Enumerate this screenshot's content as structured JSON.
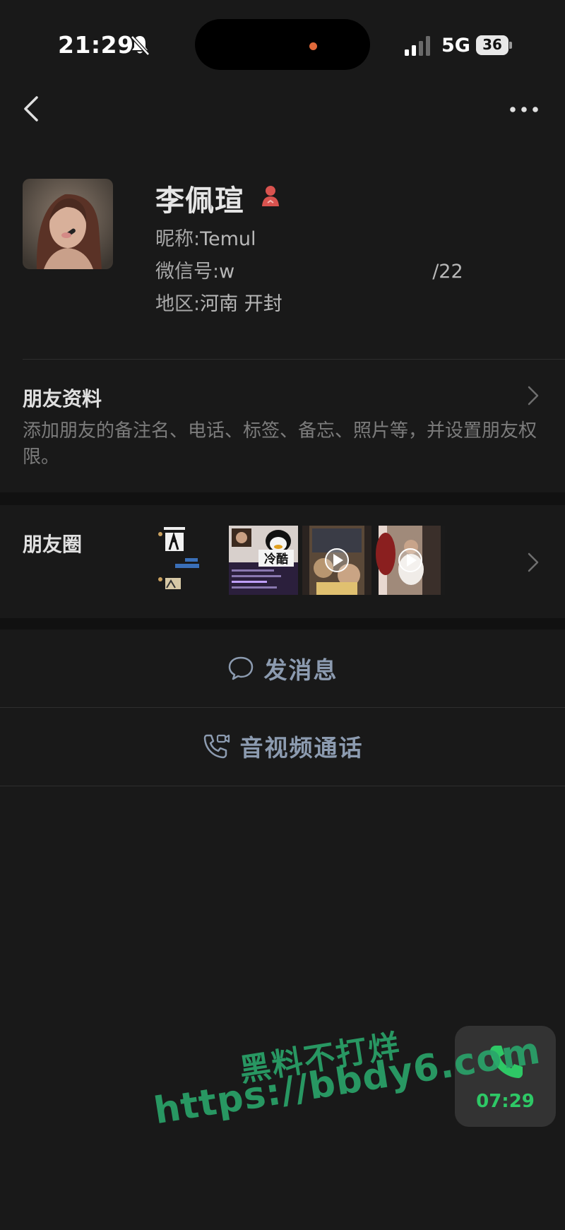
{
  "status_bar": {
    "time": "21:29",
    "network": "5G",
    "battery": "36"
  },
  "profile": {
    "name": "李佩瑄",
    "nickname_label": "昵称:",
    "nickname": "Temul",
    "wechat_label": "微信号:",
    "wechat_prefix": "w",
    "wechat_suffix": "/22",
    "region_label": "地区:",
    "region": "河南 开封"
  },
  "friend_info": {
    "title": "朋友资料",
    "description": "添加朋友的备注名、电话、标签、备忘、照片等，并设置朋友权限。"
  },
  "moments": {
    "title": "朋友圈",
    "thumb_text": "冷酷"
  },
  "actions": {
    "message": "发消息",
    "call": "音视频通话"
  },
  "call_widget": {
    "time": "07:29"
  },
  "watermark": {
    "line1": "黑料不打烊",
    "line2": "https://bbdy6.com"
  },
  "colors": {
    "background": "#191919",
    "gap": "#111111",
    "action_text": "#8c9bb0",
    "call_green": "#2ec866",
    "watermark": "#2aa56b",
    "gender_female": "#d9534f"
  }
}
